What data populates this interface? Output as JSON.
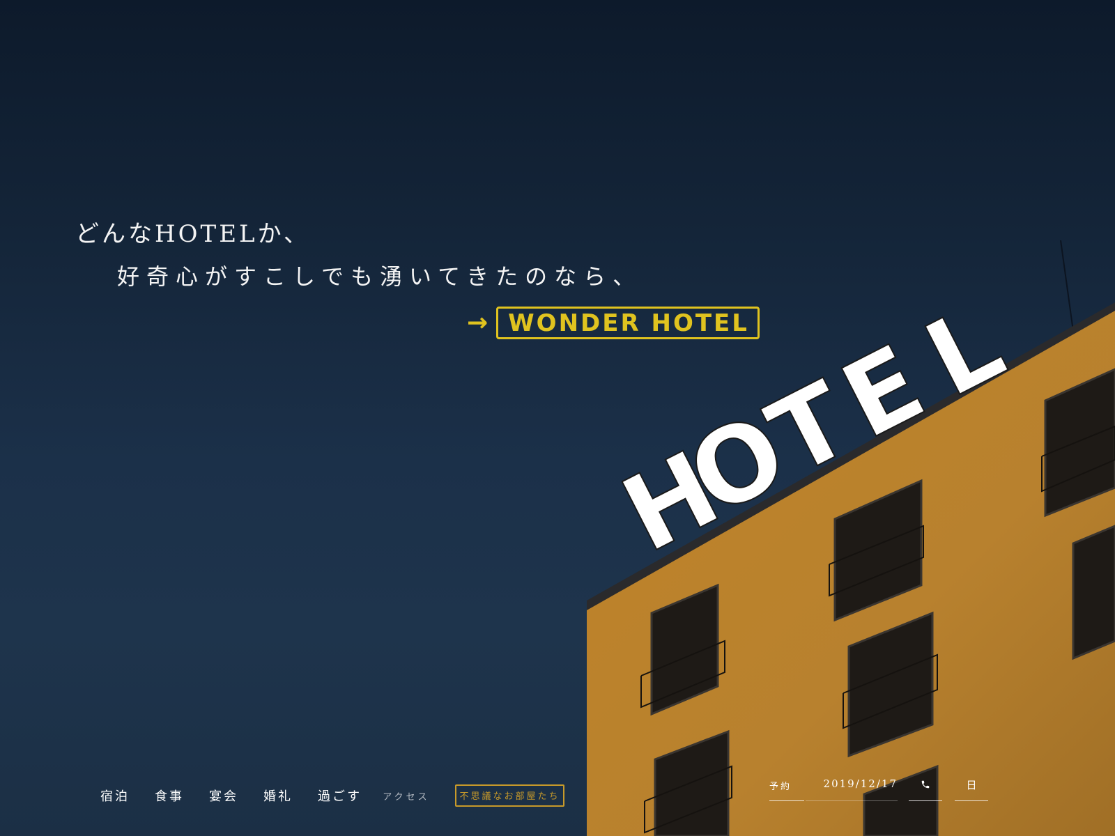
{
  "hero": {
    "line1": "どんなHOTELか、",
    "line2": "好奇心がすこしでも湧いてきたのなら、",
    "cta_arrow": "→",
    "cta_label": "WONDER HOTEL",
    "sign_letters": [
      "H",
      "O",
      "T",
      "E",
      "L"
    ]
  },
  "nav": {
    "items": [
      "宿泊",
      "食事",
      "宴会",
      "婚礼",
      "過ごす"
    ],
    "access": "アクセス",
    "special": "不思議なお部屋たち"
  },
  "booking": {
    "label": "予約",
    "date": "2019/12/17",
    "phone_icon": "phone-icon",
    "day": "日"
  },
  "colors": {
    "accent_yellow": "#e0c31f",
    "accent_gold": "#c89a2a",
    "building": "#c48a2c",
    "sky_top": "#0d1a2b",
    "sky_bottom": "#1e344c"
  }
}
